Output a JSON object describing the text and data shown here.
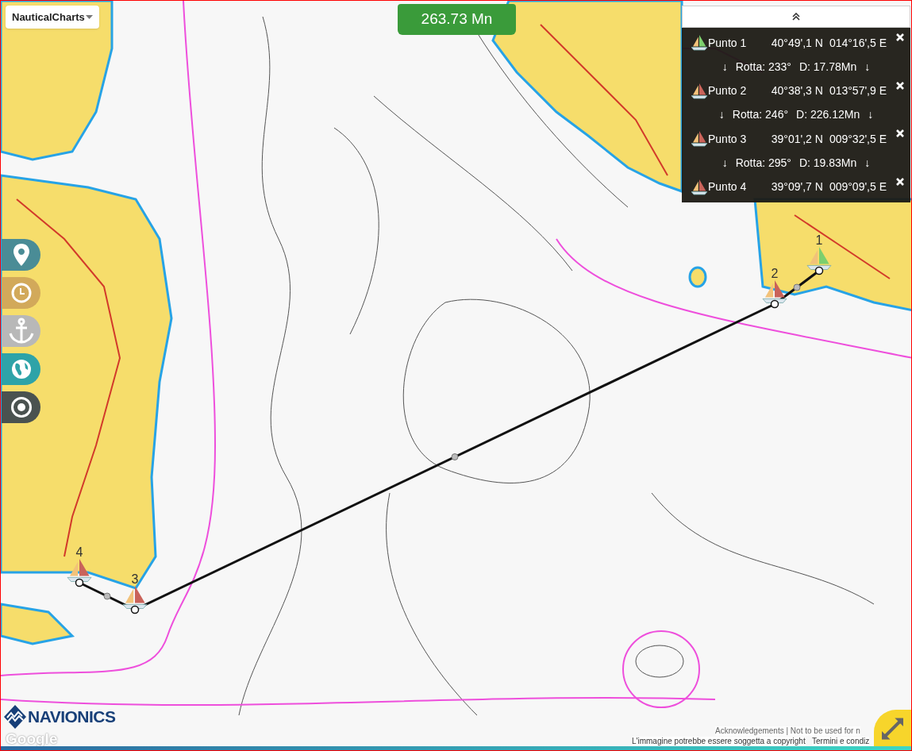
{
  "map_selector": {
    "label": "NauticalCharts"
  },
  "total_distance": "263.73 Mn",
  "route_panel": {
    "waypoints": [
      {
        "name": "Punto 1",
        "latitude": "40°49',1 N",
        "longitude": "014°16',5 E",
        "color": "#7ccf6e"
      },
      {
        "name": "Punto 2",
        "latitude": "40°38',3 N",
        "longitude": "013°57',9 E",
        "color": "#c9635a"
      },
      {
        "name": "Punto 3",
        "latitude": "39°01',2 N",
        "longitude": "009°32',5 E",
        "color": "#c9635a"
      },
      {
        "name": "Punto 4",
        "latitude": "39°09',7 N",
        "longitude": "009°09',5 E",
        "color": "#c9635a"
      }
    ],
    "legs": [
      {
        "left_arrow": "↓",
        "course": "Rotta: 233°",
        "distance": "D: 17.78Mn",
        "right_arrow": "↓"
      },
      {
        "left_arrow": "↓",
        "course": "Rotta: 246°",
        "distance": "D: 226.12Mn",
        "right_arrow": "↓"
      },
      {
        "left_arrow": "↓",
        "course": "Rotta: 295°",
        "distance": "D: 19.83Mn",
        "right_arrow": "↓"
      }
    ]
  },
  "route_markers": [
    {
      "label": "1",
      "color": "#7ccf6e"
    },
    {
      "label": "2",
      "color": "#c9635a"
    },
    {
      "label": "3",
      "color": "#c9635a"
    },
    {
      "label": "4",
      "color": "#c9635a"
    }
  ],
  "brand": {
    "logo": "NAVIONICS",
    "map_credit": "Google"
  },
  "attribution": {
    "notice": "Acknowledgements | Not to be used for n",
    "copyright": "L'immagine potrebbe essere soggetta a copyright",
    "terms": "Termini e condiz"
  }
}
